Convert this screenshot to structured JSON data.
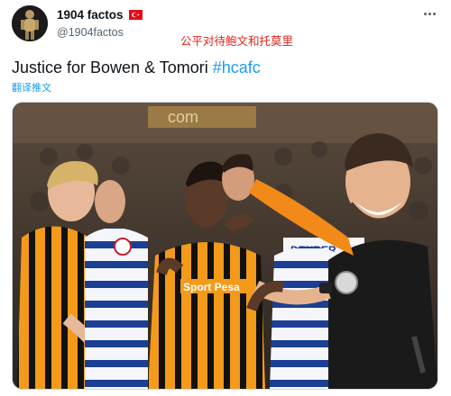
{
  "account": {
    "display_name": "1904 factos",
    "handle": "@1904factos",
    "flag_icon": "turkey-flag-icon"
  },
  "annotation_text": "公平对待鲍文和托莫里",
  "tweet": {
    "text_prefix": "Justice for Bowen & Tomori ",
    "hashtag": "#hcafc",
    "translate_label": "翻译推文"
  },
  "photo": {
    "shirt_sponsor": "Sport Pesa",
    "board_text": "DENBER",
    "stand_text": "com"
  },
  "colors": {
    "hull_amber": "#f39a1a",
    "hull_black": "#111111",
    "reading_blue": "#1c3f94",
    "referee_sleeve": "#f28a1a",
    "link_blue": "#1d9bf0",
    "annotation_red": "#e0241b"
  }
}
